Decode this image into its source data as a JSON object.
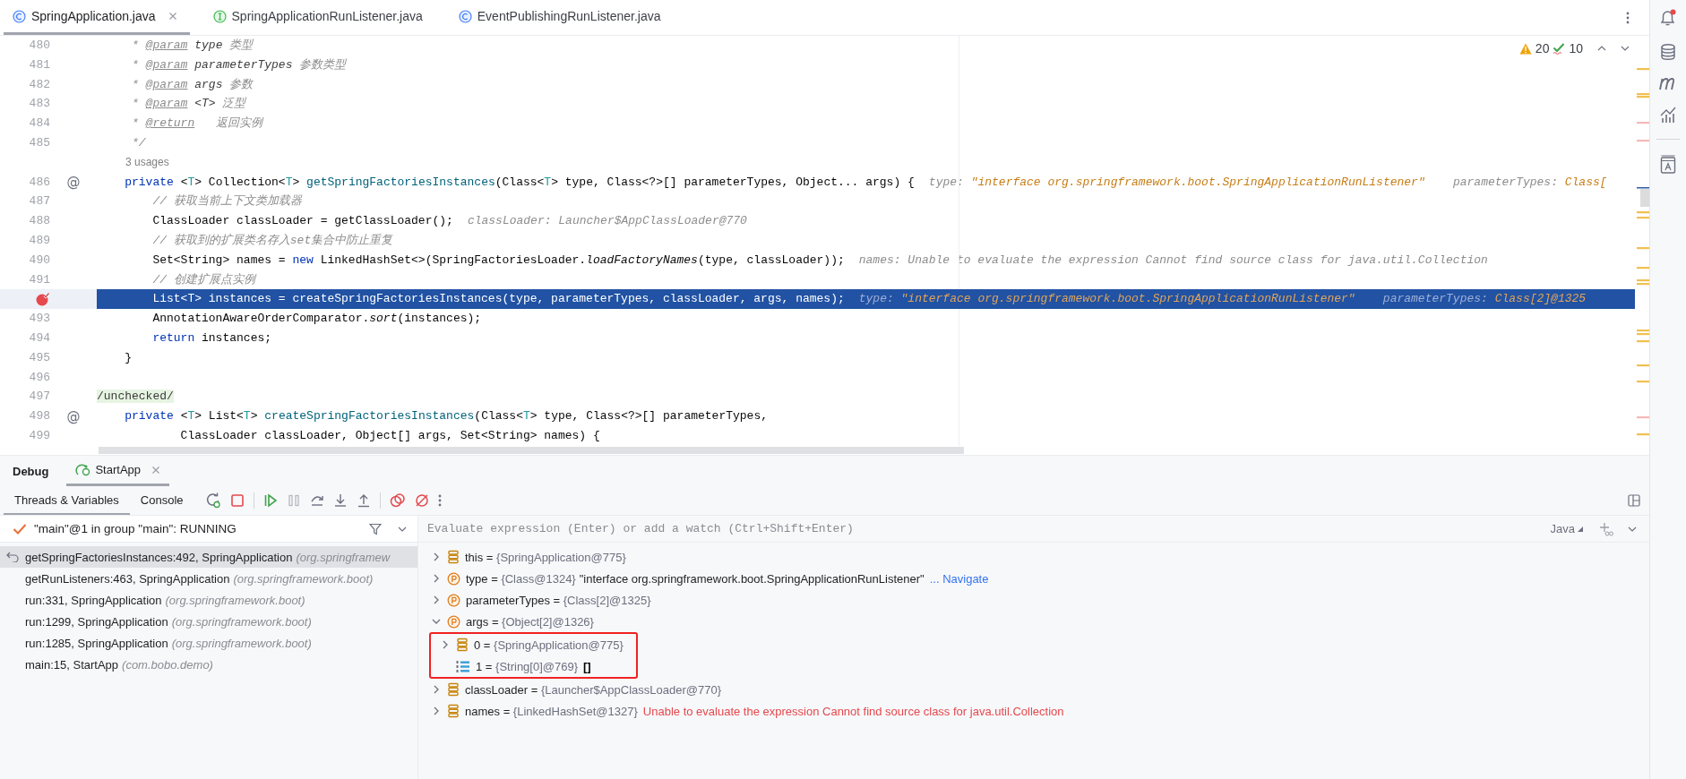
{
  "editor_tabs": [
    {
      "label": "SpringApplication.java",
      "kind": "class",
      "selected": true,
      "closable": true
    },
    {
      "label": "SpringApplicationRunListener.java",
      "kind": "interface",
      "selected": false,
      "closable": false
    },
    {
      "label": "EventPublishingRunListener.java",
      "kind": "class",
      "selected": false,
      "closable": false
    }
  ],
  "notifications": {
    "unread": true
  },
  "inspections": {
    "warnings": "20",
    "weak_warnings": "10"
  },
  "code_lines": [
    {
      "kind": "code",
      "number": "480",
      "highlighted": false,
      "breakpoint": false,
      "code": [
        {
          "kind": "comment",
          "text": "     * "
        },
        {
          "kind": "doctag",
          "text": "@param"
        },
        {
          "kind": "docparam",
          "text": " type"
        },
        {
          "kind": "comment",
          "text": " 类型"
        }
      ]
    },
    {
      "kind": "code",
      "number": "481",
      "highlighted": false,
      "breakpoint": false,
      "code": [
        {
          "kind": "comment",
          "text": "     * "
        },
        {
          "kind": "doctag",
          "text": "@param"
        },
        {
          "kind": "docparam",
          "text": " parameterTypes"
        },
        {
          "kind": "comment",
          "text": " 参数类型"
        }
      ]
    },
    {
      "kind": "code",
      "number": "482",
      "highlighted": false,
      "breakpoint": false,
      "code": [
        {
          "kind": "comment",
          "text": "     * "
        },
        {
          "kind": "doctag",
          "text": "@param"
        },
        {
          "kind": "docparam",
          "text": " args"
        },
        {
          "kind": "comment",
          "text": " 参数"
        }
      ]
    },
    {
      "kind": "code",
      "number": "483",
      "highlighted": false,
      "breakpoint": false,
      "code": [
        {
          "kind": "comment",
          "text": "     * "
        },
        {
          "kind": "doctag",
          "text": "@param"
        },
        {
          "kind": "docparam",
          "text": " <T>"
        },
        {
          "kind": "comment",
          "text": " 泛型"
        }
      ]
    },
    {
      "kind": "code",
      "number": "484",
      "highlighted": false,
      "breakpoint": false,
      "code": [
        {
          "kind": "comment",
          "text": "     * "
        },
        {
          "kind": "doctag",
          "text": "@return"
        },
        {
          "kind": "comment",
          "text": "   返回实例"
        }
      ]
    },
    {
      "kind": "code",
      "number": "485",
      "highlighted": false,
      "breakpoint": false,
      "code": [
        {
          "kind": "comment",
          "text": "     */"
        }
      ]
    },
    {
      "kind": "inlay",
      "text": "3 usages"
    },
    {
      "kind": "code",
      "number": "486",
      "highlighted": false,
      "breakpoint": false,
      "gutter_mark": "@",
      "code": [
        {
          "kind": "keyword",
          "text": "    private"
        },
        {
          "kind": "plain",
          "text": " <"
        },
        {
          "kind": "typeparam",
          "text": "T"
        },
        {
          "kind": "plain",
          "text": "> Collection<"
        },
        {
          "kind": "typeparam",
          "text": "T"
        },
        {
          "kind": "plain",
          "text": "> "
        },
        {
          "kind": "method",
          "text": "getSpringFactoriesInstances"
        },
        {
          "kind": "plain",
          "text": "(Class<"
        },
        {
          "kind": "typeparam",
          "text": "T"
        },
        {
          "kind": "plain",
          "text": "> type, Class<?>[] parameterTypes, Object... args) {"
        }
      ],
      "hint": [
        {
          "kind": "label",
          "text": "type: "
        },
        {
          "kind": "value",
          "text": "\"interface org.springframework.boot.SpringApplicationRunListener\""
        },
        {
          "kind": "label",
          "text": "    parameterTypes: "
        },
        {
          "kind": "value",
          "text": "Class["
        }
      ]
    },
    {
      "kind": "code",
      "number": "487",
      "highlighted": false,
      "breakpoint": false,
      "code": [
        {
          "kind": "comment",
          "text": "        // 获取当前上下文类加载器"
        }
      ]
    },
    {
      "kind": "code",
      "number": "488",
      "highlighted": false,
      "breakpoint": false,
      "code": [
        {
          "kind": "plain",
          "text": "        ClassLoader classLoader = getClassLoader();"
        }
      ],
      "hint": [
        {
          "kind": "label",
          "text": "classLoader: Launcher$AppClassLoader@770"
        }
      ]
    },
    {
      "kind": "code",
      "number": "489",
      "highlighted": false,
      "breakpoint": false,
      "code": [
        {
          "kind": "comment",
          "text": "        // 获取到的扩展类名存入set集合中防止重复"
        }
      ]
    },
    {
      "kind": "code",
      "number": "490",
      "highlighted": false,
      "breakpoint": false,
      "code": [
        {
          "kind": "plain",
          "text": "        Set<String> names = "
        },
        {
          "kind": "keyword",
          "text": "new"
        },
        {
          "kind": "plain",
          "text": " LinkedHashSet<>(SpringFactoriesLoader."
        },
        {
          "kind": "static",
          "text": "loadFactoryNames"
        },
        {
          "kind": "plain",
          "text": "(type, classLoader));"
        }
      ],
      "hint": [
        {
          "kind": "label",
          "text": "names: Unable to evaluate the expression Cannot find source class for java.util.Collection"
        }
      ]
    },
    {
      "kind": "code",
      "number": "491",
      "highlighted": false,
      "breakpoint": false,
      "code": [
        {
          "kind": "comment",
          "text": "        // 创建扩展点实例"
        }
      ]
    },
    {
      "kind": "code",
      "highlighted": true,
      "breakpoint": true,
      "code": [
        {
          "kind": "plain",
          "text": "        List<T> instances = createSpringFactoriesInstances(type, parameterTypes, classLoader, args, names);"
        }
      ],
      "hint": [
        {
          "kind": "label",
          "text": "type: "
        },
        {
          "kind": "value",
          "text": "\"interface org.springframework.boot.SpringApplicationRunListener\""
        },
        {
          "kind": "label",
          "text": "    parameterTypes: "
        },
        {
          "kind": "value",
          "text": "Class[2]@1325"
        }
      ]
    },
    {
      "kind": "code",
      "number": "493",
      "highlighted": false,
      "breakpoint": false,
      "code": [
        {
          "kind": "plain",
          "text": "        AnnotationAwareOrderComparator."
        },
        {
          "kind": "static",
          "text": "sort"
        },
        {
          "kind": "plain",
          "text": "(instances);"
        }
      ]
    },
    {
      "kind": "code",
      "number": "494",
      "highlighted": false,
      "breakpoint": false,
      "code": [
        {
          "kind": "keyword",
          "text": "        return"
        },
        {
          "kind": "plain",
          "text": " instances;"
        }
      ]
    },
    {
      "kind": "code",
      "number": "495",
      "highlighted": false,
      "breakpoint": false,
      "code": [
        {
          "kind": "plain",
          "text": "    }"
        }
      ]
    },
    {
      "kind": "code",
      "number": "496",
      "highlighted": false,
      "breakpoint": false
    },
    {
      "kind": "code",
      "number": "497",
      "highlighted": false,
      "breakpoint": false,
      "code": [
        {
          "kind": "annotation",
          "text": "/unchecked/"
        }
      ]
    },
    {
      "kind": "code",
      "number": "498",
      "highlighted": false,
      "breakpoint": false,
      "gutter_mark": "@",
      "code": [
        {
          "kind": "keyword",
          "text": "    private"
        },
        {
          "kind": "plain",
          "text": " <"
        },
        {
          "kind": "typeparam",
          "text": "T"
        },
        {
          "kind": "plain",
          "text": "> List<"
        },
        {
          "kind": "typeparam",
          "text": "T"
        },
        {
          "kind": "plain",
          "text": "> "
        },
        {
          "kind": "method",
          "text": "createSpringFactoriesInstances"
        },
        {
          "kind": "plain",
          "text": "(Class<"
        },
        {
          "kind": "typeparam",
          "text": "T"
        },
        {
          "kind": "plain",
          "text": "> type, Class<?>[] parameterTypes,"
        }
      ]
    },
    {
      "kind": "code",
      "number": "499",
      "highlighted": false,
      "breakpoint": false,
      "code": [
        {
          "kind": "plain",
          "text": "            ClassLoader classLoader, Object[] args, Set<String> names) {"
        }
      ]
    }
  ],
  "debug": {
    "title": "Debug",
    "run_tabs": [
      {
        "label": "StartApp",
        "selected": true
      }
    ],
    "view_tabs": [
      {
        "label": "Threads & Variables",
        "selected": true
      },
      {
        "label": "Console",
        "selected": false
      }
    ],
    "thread": "\"main\"@1 in group \"main\": RUNNING",
    "frames": [
      {
        "method": "getSpringFactoriesInstances:492, SpringApplication",
        "package": "(org.springframew",
        "selected": true
      },
      {
        "method": "getRunListeners:463, SpringApplication",
        "package": "(org.springframework.boot)",
        "selected": false
      },
      {
        "method": "run:331, SpringApplication",
        "package": "(org.springframework.boot)",
        "selected": false
      },
      {
        "method": "run:1299, SpringApplication",
        "package": "(org.springframework.boot)",
        "selected": false
      },
      {
        "method": "run:1285, SpringApplication",
        "package": "(org.springframework.boot)",
        "selected": false
      },
      {
        "method": "main:15, StartApp",
        "package": "(com.bobo.demo)",
        "selected": false
      }
    ],
    "evaluate": {
      "placeholder": "Evaluate expression (Enter) or add a watch (Ctrl+Shift+Enter)",
      "language": "Java"
    },
    "variables": [
      {
        "kind": "field",
        "name": "this =",
        "value": "{SpringApplication@775}",
        "expandable": true,
        "expanded": false
      },
      {
        "kind": "parameter",
        "name": "type =",
        "value": "{Class@1324}",
        "expandable": true,
        "expanded": false,
        "extras": [
          {
            "kind": "string",
            "text": "\"interface org.springframework.boot.SpringApplicationRunListener\""
          },
          {
            "kind": "link",
            "text": "... Navigate"
          }
        ]
      },
      {
        "kind": "parameter",
        "name": "parameterTypes =",
        "value": "{Class[2]@1325}",
        "expandable": true,
        "expanded": false
      },
      {
        "kind": "parameter",
        "name": "args =",
        "value": "{Object[2]@1326}",
        "expandable": true,
        "expanded": true,
        "children_marked": true,
        "children": [
          {
            "kind": "field",
            "name": "0 =",
            "value": "{SpringApplication@775}",
            "expandable": true,
            "expanded": false
          },
          {
            "kind": "array",
            "name": "1 =",
            "value": "{String[0]@769}",
            "expandable": false,
            "extras": [
              {
                "kind": "plain",
                "text": "[]"
              }
            ]
          }
        ]
      },
      {
        "kind": "field",
        "name": "classLoader =",
        "value": "{Launcher$AppClassLoader@770}",
        "expandable": true,
        "expanded": false
      },
      {
        "kind": "field",
        "name": "names =",
        "value": "{LinkedHashSet@1327}",
        "expandable": true,
        "expanded": false,
        "extras": [
          {
            "kind": "error",
            "text": "Unable to evaluate the expression Cannot find source class for java.util.Collection"
          }
        ]
      }
    ]
  }
}
